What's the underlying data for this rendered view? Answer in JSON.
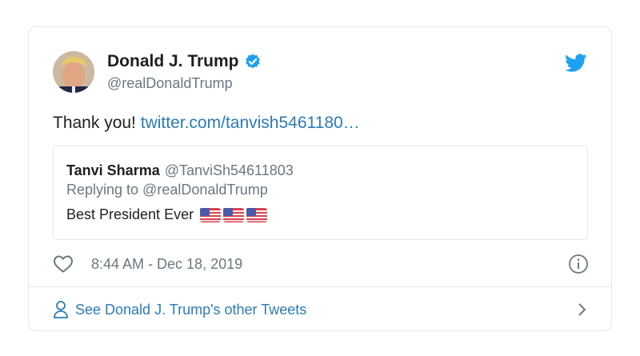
{
  "tweet": {
    "author_name": "Donald J. Trump",
    "author_handle": "@realDonaldTrump",
    "text": "Thank you!",
    "link": "twitter.com/tanvish5461180…",
    "timestamp": "8:44 AM - Dec 18, 2019"
  },
  "quoted": {
    "name": "Tanvi Sharma",
    "handle": "@TanviSh54611803",
    "reply_to": "Replying to @realDonaldTrump",
    "text": "Best President Ever"
  },
  "footer": {
    "link": "See Donald J. Trump's other Tweets"
  },
  "colors": {
    "link": "#2b7bb9",
    "muted": "#697882",
    "border": "#e1e8ed",
    "verified": "#1da1f2",
    "twitter_blue": "#1da1f2"
  },
  "icons": [
    "twitter-bird-icon",
    "verified-badge-icon",
    "heart-icon",
    "info-icon",
    "person-icon",
    "chevron-right-icon",
    "us-flag-icon"
  ]
}
